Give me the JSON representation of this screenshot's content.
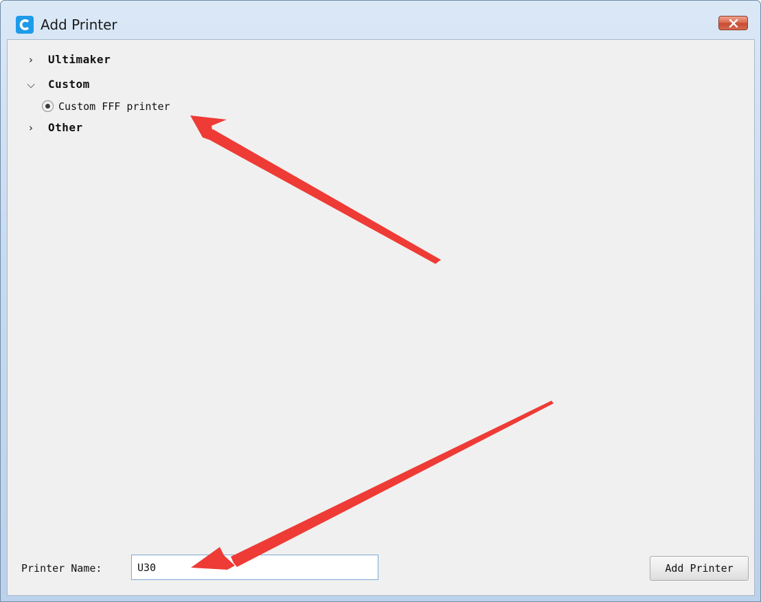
{
  "window": {
    "title": "Add Printer",
    "app_icon": "cura-logo-icon",
    "close_icon": "close-icon"
  },
  "tree": {
    "categories": [
      {
        "label": "Ultimaker",
        "expanded": false,
        "icon": "chevron-right-icon"
      },
      {
        "label": "Custom",
        "expanded": true,
        "icon": "chevron-down-icon"
      },
      {
        "label": "Other",
        "expanded": false,
        "icon": "chevron-right-icon"
      }
    ],
    "custom_option": {
      "label": "Custom FFF printer",
      "selected": true
    }
  },
  "form": {
    "printer_name_label": "Printer Name:",
    "printer_name_value": "U30",
    "add_button_label": "Add Printer"
  },
  "colors": {
    "accent_icon": "#1e9be9",
    "annotation_arrow": "#ee3b36",
    "close_button": "#d4593e"
  }
}
